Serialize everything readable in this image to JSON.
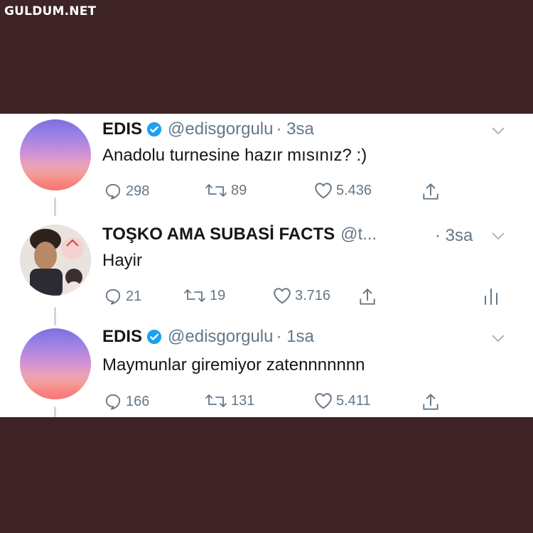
{
  "watermark": "GULDUM.NET",
  "tweets": [
    {
      "name": "EDIS",
      "handle": "@edisgorgulu",
      "time": "· 3sa",
      "text": "Anadolu turnesine hazır mısınız? :)",
      "replies": "298",
      "retweets": "89",
      "likes": "5.436"
    },
    {
      "name": "TOŞKO AMA SUBASİ FACTS",
      "handle": "@t...",
      "time": "· 3sa",
      "text": "Hayir",
      "replies": "21",
      "retweets": "19",
      "likes": "3.716"
    },
    {
      "name": "EDIS",
      "handle": "@edisgorgulu",
      "time": "· 1sa",
      "text": "Maymunlar giremiyor zatennnnnnn",
      "replies": "166",
      "retweets": "131",
      "likes": "5.411"
    }
  ],
  "colors": {
    "background": "#3e2426",
    "verified": "#1da1f2",
    "muted": "#657786",
    "text": "#14171a"
  }
}
